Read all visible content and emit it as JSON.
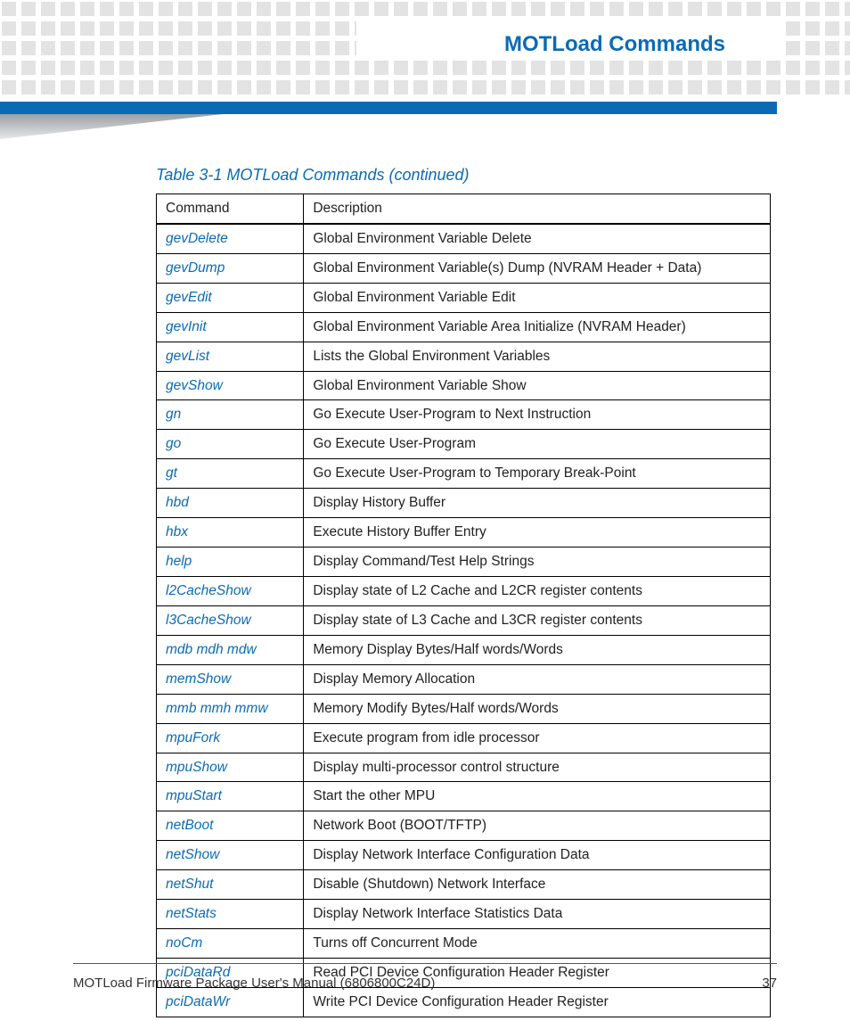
{
  "header": {
    "title": "MOTLoad Commands"
  },
  "caption": "Table 3-1 MOTLoad Commands (continued)",
  "columns": {
    "c0": "Command",
    "c1": "Description"
  },
  "rows": [
    {
      "cmd": "gevDelete",
      "desc": "Global Environment Variable Delete"
    },
    {
      "cmd": "gevDump",
      "desc": "Global Environment Variable(s) Dump (NVRAM Header + Data)"
    },
    {
      "cmd": "gevEdit",
      "desc": "Global Environment Variable Edit"
    },
    {
      "cmd": "gevInit",
      "desc": "Global Environment Variable Area Initialize (NVRAM Header)"
    },
    {
      "cmd": "gevList",
      "desc": "Lists the Global Environment Variables"
    },
    {
      "cmd": "gevShow",
      "desc": "Global Environment Variable Show"
    },
    {
      "cmd": "gn",
      "desc": "Go Execute User-Program to Next Instruction"
    },
    {
      "cmd": "go",
      "desc": "Go Execute User-Program"
    },
    {
      "cmd": "gt",
      "desc": "Go Execute User-Program to Temporary Break-Point"
    },
    {
      "cmd": "hbd",
      "desc": "Display History Buffer"
    },
    {
      "cmd": "hbx",
      "desc": "Execute History Buffer Entry"
    },
    {
      "cmd": "help",
      "desc": "Display Command/Test Help Strings"
    },
    {
      "cmd": "l2CacheShow",
      "desc": "Display state of L2 Cache and L2CR register contents"
    },
    {
      "cmd": "l3CacheShow",
      "desc": "Display state of L3 Cache and L3CR register contents"
    },
    {
      "cmd": "mdb mdh mdw",
      "desc": "Memory Display Bytes/Half words/Words"
    },
    {
      "cmd": "memShow",
      "desc": "Display Memory Allocation"
    },
    {
      "cmd": "mmb mmh mmw",
      "desc": "Memory Modify Bytes/Half words/Words"
    },
    {
      "cmd": "mpuFork",
      "desc": "Execute program from idle processor"
    },
    {
      "cmd": "mpuShow",
      "desc": "Display multi-processor control structure"
    },
    {
      "cmd": "mpuStart",
      "desc": "Start the other MPU"
    },
    {
      "cmd": "netBoot",
      "desc": "Network Boot (BOOT/TFTP)"
    },
    {
      "cmd": "netShow",
      "desc": "Display Network Interface Configuration Data"
    },
    {
      "cmd": "netShut",
      "desc": "Disable (Shutdown) Network Interface"
    },
    {
      "cmd": "netStats",
      "desc": "Display Network Interface Statistics Data"
    },
    {
      "cmd": "noCm",
      "desc": "Turns off Concurrent Mode"
    },
    {
      "cmd": "pciDataRd",
      "desc": "Read PCI Device Configuration Header Register"
    },
    {
      "cmd": "pciDataWr",
      "desc": "Write PCI Device Configuration Header Register"
    }
  ],
  "footer": {
    "manual": "MOTLoad Firmware Package User's Manual (6806800C24D)",
    "page": "37"
  }
}
